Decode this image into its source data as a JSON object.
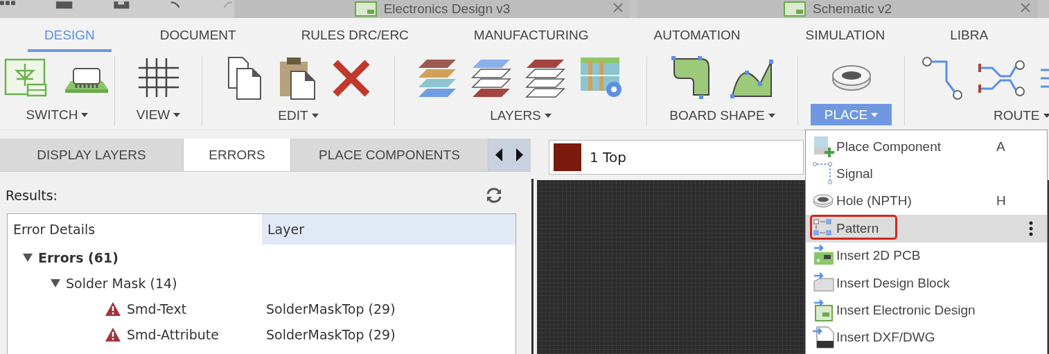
{
  "document_tabs": [
    {
      "title": "Electronics Design v3"
    },
    {
      "title": "Schematic v2"
    }
  ],
  "ribbon_tabs": [
    {
      "label": "DESIGN",
      "selected": true
    },
    {
      "label": "DOCUMENT",
      "selected": false
    },
    {
      "label": "RULES DRC/ERC",
      "selected": false
    },
    {
      "label": "MANUFACTURING",
      "selected": false
    },
    {
      "label": "AUTOMATION",
      "selected": false
    },
    {
      "label": "SIMULATION",
      "selected": false
    },
    {
      "label": "LIBRA",
      "selected": false
    }
  ],
  "ribbon_groups": [
    {
      "label": "SWITCH",
      "selected": false
    },
    {
      "label": "VIEW",
      "selected": false
    },
    {
      "label": "EDIT",
      "selected": false
    },
    {
      "label": "LAYERS",
      "selected": false
    },
    {
      "label": "BOARD SHAPE",
      "selected": false
    },
    {
      "label": "PLACE",
      "selected": true
    },
    {
      "label": "ROUTE",
      "selected": false
    }
  ],
  "panel_tabs": [
    {
      "label": "DISPLAY LAYERS",
      "selected": false
    },
    {
      "label": "ERRORS",
      "selected": true
    },
    {
      "label": "PLACE COMPONENTS",
      "selected": false
    }
  ],
  "results_label": "Results:",
  "error_table": {
    "columns": [
      "Error Details",
      "Layer"
    ],
    "rows": [
      {
        "label": "Errors (61)",
        "expanded": true,
        "children": [
          {
            "label": "Solder Mask (14)",
            "expanded": true,
            "children": [
              {
                "label": "Smd-Text",
                "layer": "SolderMaskTop (29)",
                "kind": "error"
              },
              {
                "label": "Smd-Attribute",
                "layer": "SolderMaskTop (29)",
                "kind": "error"
              }
            ]
          }
        ]
      }
    ]
  },
  "layer_select": {
    "value": "1 Top"
  },
  "place_menu": {
    "items": [
      {
        "label": "Place Component",
        "shortcut": "A",
        "selected": false
      },
      {
        "label": "Signal",
        "selected": false
      },
      {
        "label": "Hole (NPTH)",
        "shortcut": "H",
        "selected": false
      },
      {
        "label": "Pattern",
        "selected": true
      },
      {
        "label": "Insert 2D PCB",
        "selected": false
      },
      {
        "label": "Insert Design Block",
        "selected": false
      },
      {
        "label": "Insert Electronic Design",
        "selected": false
      },
      {
        "label": "Insert DXF/DWG",
        "selected": false
      }
    ]
  }
}
